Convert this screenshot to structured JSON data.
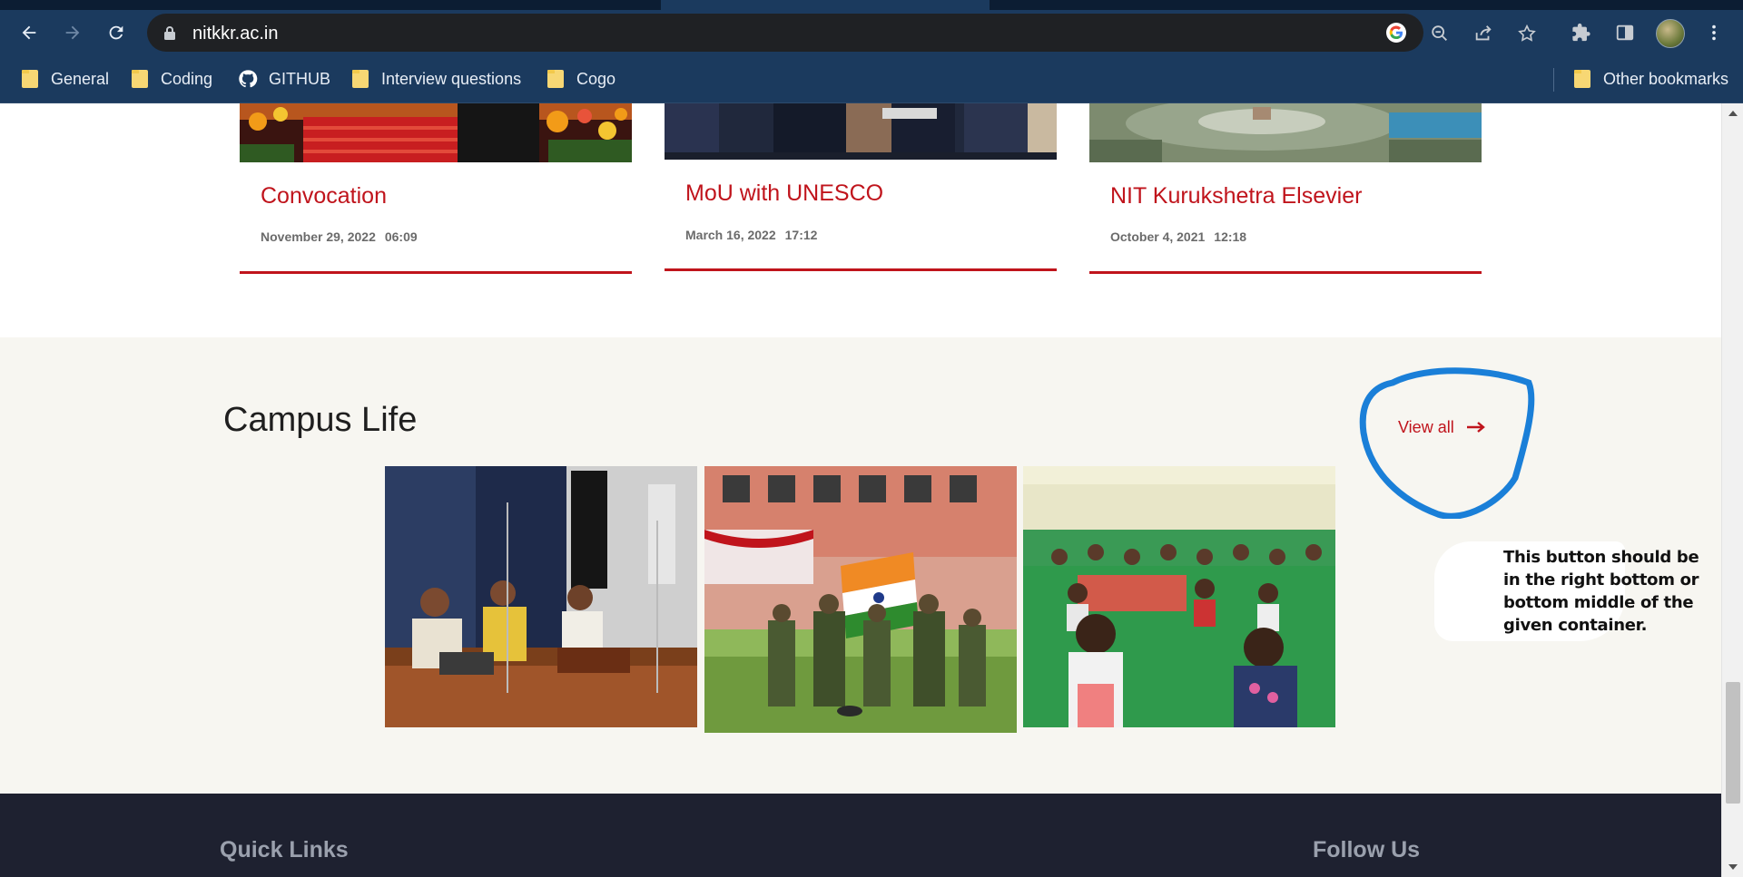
{
  "browser": {
    "url": "nitkkr.ac.in",
    "bookmarks": [
      "General",
      "Coding",
      "GITHUB",
      "Interview questions",
      "Cogo"
    ],
    "other_bookmarks": "Other bookmarks"
  },
  "news": [
    {
      "title": "Convocation",
      "date": "November 29, 2022",
      "time": "06:09"
    },
    {
      "title": "MoU with UNESCO",
      "date": "March 16, 2022",
      "time": "17:12"
    },
    {
      "title": "NIT Kurukshetra Elsevier",
      "date": "October 4, 2021",
      "time": "12:18"
    }
  ],
  "campus": {
    "title": "Campus Life",
    "view_all": "View all",
    "annotation": "This button should be in the right bottom or bottom middle of the given container."
  },
  "footer": {
    "quick_links": "Quick Links",
    "follow_us": "Follow Us"
  },
  "colors": {
    "accent_red": "#c0141c",
    "chrome_blue": "#1b3a5e",
    "annotation_blue": "#1a7fd8",
    "footer_bg": "#1e2130"
  }
}
